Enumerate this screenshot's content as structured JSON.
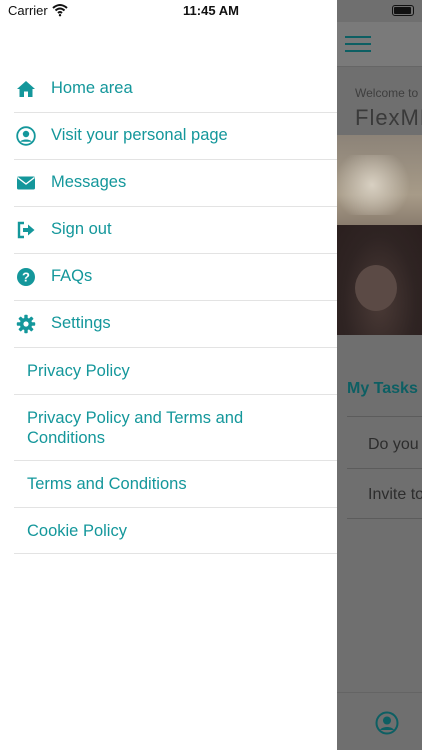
{
  "status_bar": {
    "carrier": "Carrier",
    "time": "11:45 AM"
  },
  "menu": {
    "items": [
      {
        "label": "Home area",
        "icon": "home-icon"
      },
      {
        "label": "Visit your personal page",
        "icon": "user-circle-icon"
      },
      {
        "label": "Messages",
        "icon": "envelope-icon"
      },
      {
        "label": "Sign out",
        "icon": "sign-out-icon"
      },
      {
        "label": "FAQs",
        "icon": "question-circle-icon"
      },
      {
        "label": "Settings",
        "icon": "gear-icon"
      }
    ],
    "links": [
      {
        "label": "Privacy Policy"
      },
      {
        "label": "Privacy Policy and Terms and Conditions"
      },
      {
        "label": "Terms and Conditions"
      },
      {
        "label": "Cookie Policy"
      }
    ]
  },
  "background_page": {
    "welcome_text": "Welcome to",
    "brand": "FlexMR",
    "section_title": "My Tasks",
    "tasks": [
      {
        "text": "Do you"
      },
      {
        "text": "Invite to"
      }
    ]
  },
  "colors": {
    "accent": "#14979b",
    "overlay": "#6f6f6f",
    "dark_teal": "#0d5f63"
  }
}
